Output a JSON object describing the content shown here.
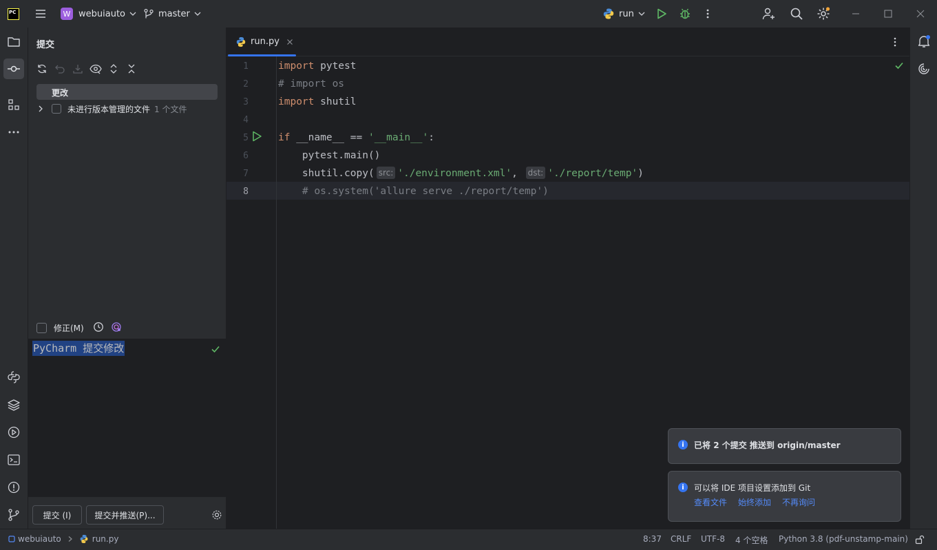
{
  "titlebar": {
    "logo": "PC",
    "project_initial": "W",
    "project": "webuiauto",
    "branch": "master",
    "run_config": "run"
  },
  "commit_panel": {
    "title": "提交",
    "changes_label": "更改",
    "unversioned_label": "未进行版本管理的文件",
    "unversioned_count": "1 个文件",
    "amend_label": "修正(M)",
    "commit_message": "PyCharm 提交修改",
    "commit_button": "提交 (I)",
    "commit_push_button": "提交并推送(P)..."
  },
  "editor": {
    "tab_label": "run.py",
    "line_numbers": [
      "1",
      "2",
      "3",
      "4",
      "5",
      "6",
      "7",
      "8"
    ],
    "hint_src": "src:",
    "hint_dst": "dst:"
  },
  "notifications": {
    "push": {
      "pre": "已将 ",
      "count": "2",
      "mid": " 个提交 推送到 ",
      "target": "origin/master"
    },
    "git": {
      "title": "可以将 IDE 项目设置添加到 Git",
      "view_files": "查看文件",
      "always_add": "始终添加",
      "dont_ask": "不再询问"
    }
  },
  "statusbar": {
    "project": "webuiauto",
    "file": "run.py",
    "position": "8:37",
    "line_sep": "CRLF",
    "encoding": "UTF-8",
    "indent": "4 个空格",
    "interpreter": "Python 3.8 (pdf-unstamp-main)"
  },
  "colors": {
    "accent": "#3574f0",
    "keyword": "#cf8e6d",
    "string": "#6aab73",
    "comment": "#7a7e85",
    "ok_green": "#5fb865"
  }
}
